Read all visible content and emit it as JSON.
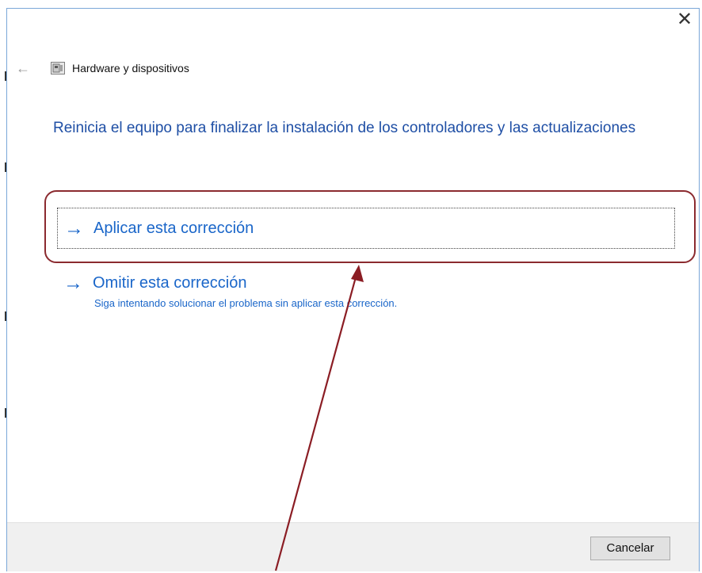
{
  "window": {
    "title": "Hardware y dispositivos",
    "close_label": "✕",
    "back_label": "←"
  },
  "content": {
    "heading": "Reinicia el equipo para finalizar la instalación de los controladores y las actualizaciones",
    "primary_option": {
      "label": "Aplicar esta corrección",
      "arrow": "→"
    },
    "secondary_option": {
      "label": "Omitir esta corrección",
      "description": "Siga intentando solucionar el problema sin aplicar esta corrección.",
      "arrow": "→"
    }
  },
  "footer": {
    "cancel_label": "Cancelar"
  },
  "annotation": {
    "color": "#8b1d24"
  },
  "colors": {
    "link_blue": "#1a66c9",
    "heading_blue": "#1f4fa5",
    "window_border": "#7aa7d8",
    "footer_bg": "#f0f0f0"
  }
}
